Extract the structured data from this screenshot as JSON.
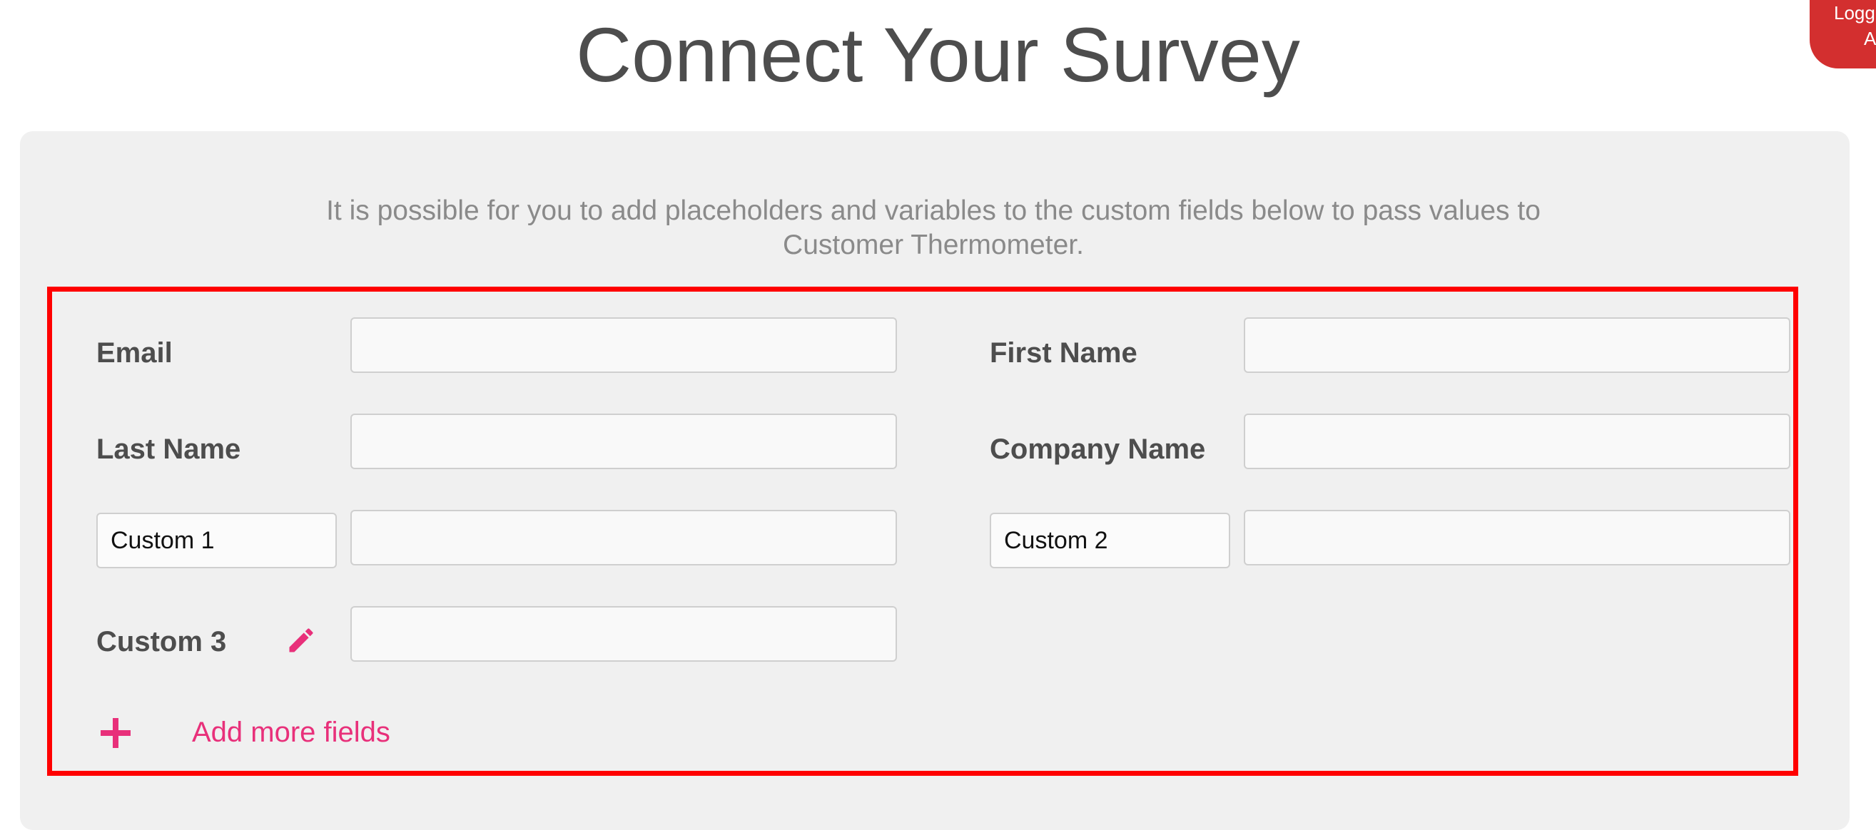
{
  "page": {
    "title": "Connect Your Survey"
  },
  "account": {
    "line1": "Logged",
    "line2": "A"
  },
  "panel": {
    "intro": "It is possible for you to add placeholders and variables to the custom fields below to pass values to Customer Thermometer."
  },
  "fields": {
    "email_label": "Email",
    "email_value": "",
    "first_name_label": "First Name",
    "first_name_value": "",
    "last_name_label": "Last Name",
    "last_name_value": "",
    "company_name_label": "Company Name",
    "company_name_value": "",
    "custom1_name": "Custom 1",
    "custom1_value": "",
    "custom2_name": "Custom 2",
    "custom2_value": "",
    "custom3_label": "Custom 3",
    "custom3_value": "",
    "add_more_label": "Add more fields"
  },
  "colors": {
    "accent": "#e8307a",
    "highlight_border": "#ff0000",
    "badge": "#d32f2f"
  },
  "icons": {
    "edit": "pencil-icon",
    "add": "plus-icon"
  }
}
